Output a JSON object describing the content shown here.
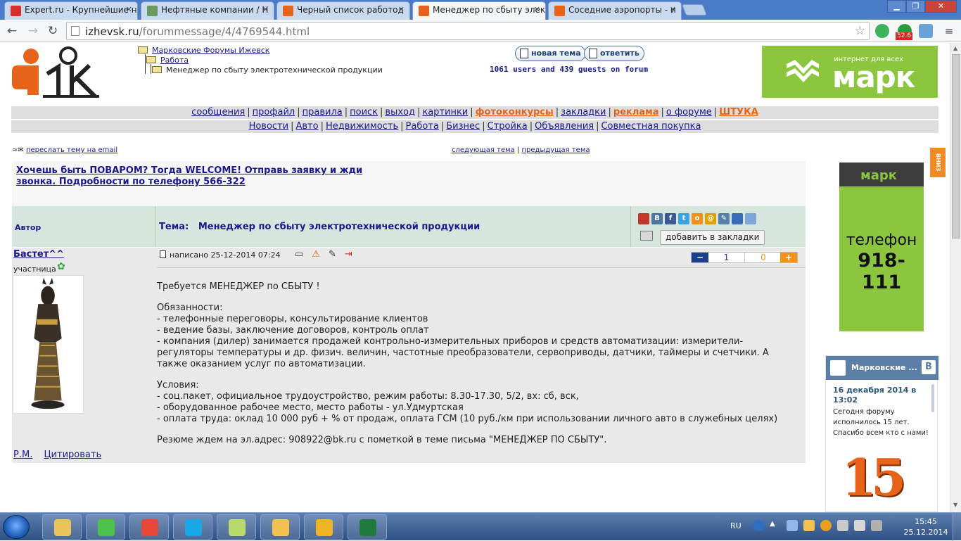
{
  "browser": {
    "tabs": [
      {
        "title": "Expert.ru - Крупнейшие н",
        "favicon_color": "#d9302c",
        "active": false
      },
      {
        "title": "Нефтяные компании / Н",
        "favicon_color": "#6b9b5e",
        "active": false
      },
      {
        "title": "Черный список работод",
        "favicon_color": "#e8631a",
        "active": false
      },
      {
        "title": "Менеджер по сбыту элек",
        "favicon_color": "#e8631a",
        "active": true
      },
      {
        "title": "Соседние аэропорты - и",
        "favicon_color": "#e8631a",
        "active": false
      }
    ],
    "url_host": "izhevsk.ru",
    "url_path": "/forummessage/4/4769544.html",
    "extension_badge": "52.6"
  },
  "header": {
    "breadcrumbs": [
      "Марковские Форумы Ижевск",
      "Работа",
      "Менеджер по сбыту электротехнической продукции"
    ],
    "new_topic": "новая тема",
    "reply": "ответить",
    "online": "1061 users and 439 guests on forum",
    "ad_top": {
      "tagline": "интернет для всех",
      "brand": "марк",
      "color": "#8cc63f"
    }
  },
  "menu1": [
    {
      "label": "сообщения",
      "highlight": false
    },
    {
      "label": "профайл",
      "highlight": false
    },
    {
      "label": "правила",
      "highlight": false
    },
    {
      "label": "поиск",
      "highlight": false
    },
    {
      "label": "выход",
      "highlight": false
    },
    {
      "label": "картинки",
      "highlight": false
    },
    {
      "label": "фотоконкурсы",
      "highlight": true
    },
    {
      "label": "закладки",
      "highlight": false
    },
    {
      "label": "реклама",
      "highlight": true
    },
    {
      "label": "о форуме",
      "highlight": false
    },
    {
      "label": "ШТУКА",
      "highlight": true
    }
  ],
  "menu2": [
    "Новости",
    "Авто",
    "Недвижимость",
    "Работа",
    "Бизнес",
    "Стройка",
    "Объявления",
    "Совместная покупка"
  ],
  "forward_link": "переслать тему на email",
  "next_topic": "следующая тема",
  "prev_topic": "предыдущая тема",
  "banner": "Хочешь быть ПОВАРОМ? Тогда WELCOME! Отправь заявку и жди звонка. Подробности по телефону 566-322",
  "table": {
    "author_header": "Автор",
    "subject_label": "Тема:",
    "subject": "Менеджер по сбыту электротехнической продукции",
    "bookmark_button": "добавить в закладки",
    "share_icons": [
      {
        "name": "email",
        "letter": "",
        "color": "#c0392b"
      },
      {
        "name": "vkontakte",
        "letter": "В",
        "color": "#4c75a3"
      },
      {
        "name": "facebook",
        "letter": "f",
        "color": "#3b5998"
      },
      {
        "name": "twitter",
        "letter": "t",
        "color": "#3aa3e3"
      },
      {
        "name": "odnoklassniki",
        "letter": "о",
        "color": "#f39217"
      },
      {
        "name": "mail-ru",
        "letter": "@",
        "color": "#e0a100"
      },
      {
        "name": "livejournal",
        "letter": "✎",
        "color": "#5a7fa6"
      },
      {
        "name": "moi-mir",
        "letter": "",
        "color": "#3a6db5"
      },
      {
        "name": "more",
        "letter": "",
        "color": "#7fa6d6"
      }
    ]
  },
  "post": {
    "author": "Бастет^^",
    "rank": "участница",
    "written": "написано 25-12-2014 07:24",
    "rating_minus": "−",
    "rating_plus": "+",
    "rating_up": "1",
    "rating_down": "0",
    "links": [
      "Р.М.",
      "Цитировать"
    ],
    "body": [
      [
        "Требуется МЕНЕДЖЕР по СБЫТУ !"
      ],
      [
        "Обязанности:",
        "- телефонные переговоры, консультирование клиентов",
        "- ведение базы, заключение договоров, контроль оплат",
        "- компания (дилер) занимается продажей контрольно-измерительных приборов и средств автоматизации: измерители-",
        "регуляторы температуры и др. физич. величин, частотные преобразователи, сервоприводы, датчики, таймеры и счетчики. А",
        "также оказанием услуг по автоматизации."
      ],
      [
        "Условия:",
        "- соц.пакет, официальное трудоустройство, режим работы: 8.30-17.30, 5/2, вх: сб, вск,",
        "- оборудованное рабочее место, место работы - ул.Удмуртская",
        "- оплата труда: оклад 10 000 руб + % от продаж, оплата ГСМ (10 руб./км при использовании личного авто в служебных целях)"
      ],
      [
        "Резюме ждем на эл.адрес: 908922@bk.ru с пометкой в теме письма \"МЕНЕДЖЕР ПО СБЫТУ\"."
      ]
    ]
  },
  "right": {
    "ad_tall": {
      "brand": "марк",
      "label": "телефон",
      "phone": "918-111"
    },
    "scroll_down": "ВНИЗ",
    "vk": {
      "group": "Марковские ...",
      "vk_letter": "В",
      "date": "16 декабря 2014 в 13:02",
      "text": "Сегодня форуму исполнилось 15 лет. Спасибо всем кто с нами!",
      "big": "15"
    }
  },
  "taskbar": {
    "apps": [
      {
        "name": "explorer",
        "color": "#e8c35a"
      },
      {
        "name": "icq",
        "color": "#4cc24c"
      },
      {
        "name": "chrome",
        "color": "#e6473b"
      },
      {
        "name": "skype",
        "color": "#18a8e8"
      },
      {
        "name": "sticky-notes",
        "color": "#b8d96b"
      },
      {
        "name": "outlook",
        "color": "#f2c14e"
      },
      {
        "name": "bee",
        "color": "#f0b323"
      },
      {
        "name": "excel",
        "color": "#1f7a3e"
      }
    ],
    "lang": "RU",
    "time": "15:45",
    "date": "25.12.2014"
  }
}
